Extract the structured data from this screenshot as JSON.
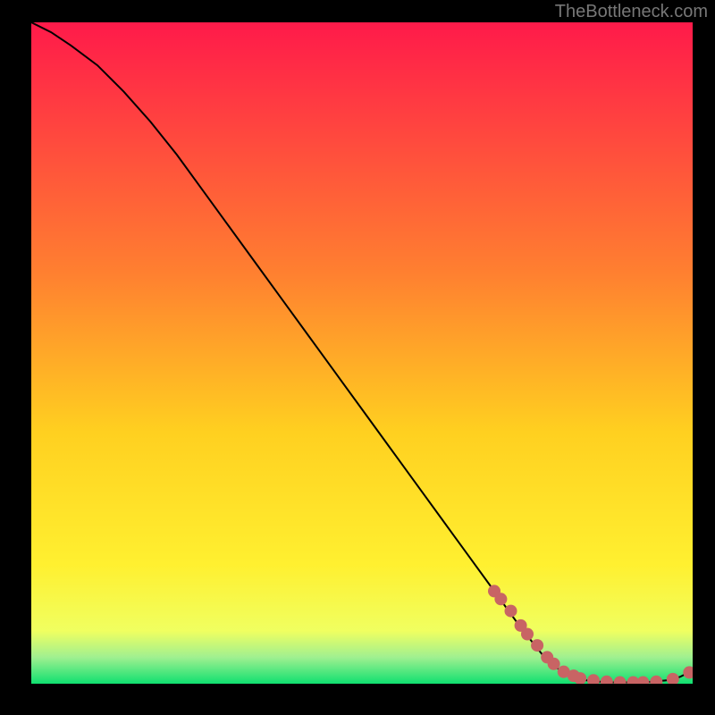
{
  "watermark": "TheBottleneck.com",
  "chart_data": {
    "type": "line",
    "title": "",
    "xlabel": "",
    "ylabel": "",
    "x_range": [
      0,
      100
    ],
    "y_range": [
      0,
      100
    ],
    "curve": {
      "x": [
        0,
        3,
        6,
        10,
        14,
        18,
        22,
        26,
        30,
        34,
        38,
        42,
        46,
        50,
        54,
        58,
        62,
        66,
        70,
        74,
        78,
        80,
        82,
        84,
        86,
        88,
        90,
        92,
        94,
        96,
        98,
        100
      ],
      "y": [
        100,
        98.5,
        96.5,
        93.5,
        89.5,
        85,
        80,
        74.5,
        69,
        63.5,
        58,
        52.5,
        47,
        41.5,
        36,
        30.5,
        25,
        19.5,
        14,
        8.5,
        3.5,
        2,
        1,
        0.5,
        0.3,
        0.2,
        0.2,
        0.2,
        0.3,
        0.5,
        1.0,
        2.0
      ]
    },
    "scatter_points": {
      "x": [
        70,
        71,
        72.5,
        74,
        75,
        76.5,
        78,
        79,
        80.5,
        82,
        83,
        85,
        87,
        89,
        91,
        92.5,
        94.5,
        97,
        99.5
      ],
      "y": [
        14,
        12.8,
        11,
        8.8,
        7.5,
        5.8,
        4,
        3,
        1.8,
        1.2,
        0.8,
        0.5,
        0.3,
        0.2,
        0.2,
        0.2,
        0.3,
        0.7,
        1.7
      ]
    },
    "colors": {
      "gradient_top": "#ff1a4a",
      "gradient_mid1": "#ff8030",
      "gradient_mid2": "#ffd020",
      "gradient_mid3": "#fff030",
      "gradient_bottom": "#10e070",
      "scatter": "#c86464",
      "curve": "#000000"
    }
  }
}
